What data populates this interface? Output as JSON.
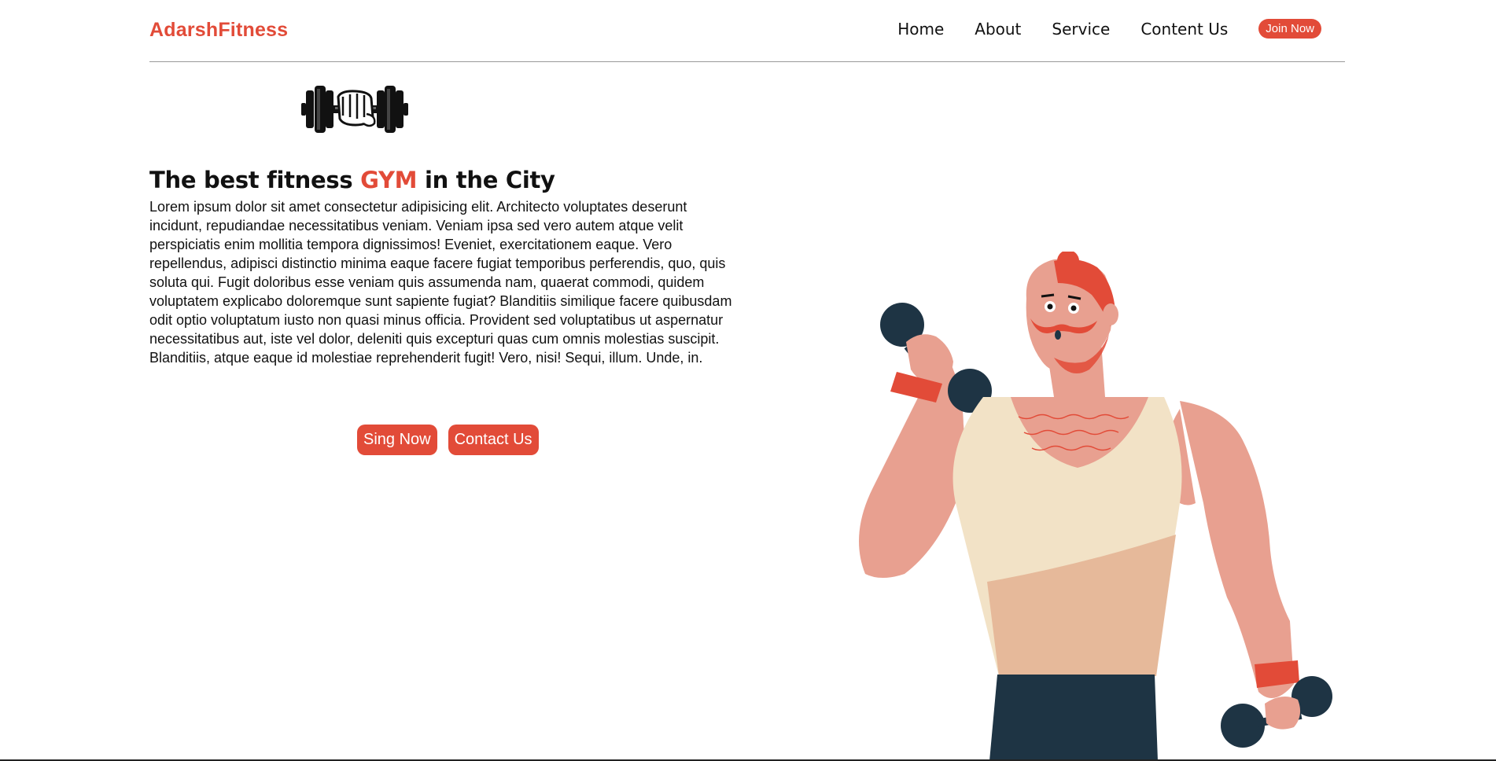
{
  "brand": "AdarshFitness",
  "nav": {
    "items": [
      "Home",
      "About",
      "Service",
      "Content Us"
    ],
    "join_label": "Join Now"
  },
  "hero": {
    "title_part1": "The best fitness ",
    "title_accent": "GYM",
    "title_part2": " in the City",
    "paragraph": "Lorem ipsum dolor sit amet consectetur adipisicing elit. Architecto voluptates deserunt incidunt, repudiandae necessitatibus veniam. Veniam ipsa sed vero autem atque velit perspiciatis enim mollitia tempora dignissimos! Eveniet, exercitationem eaque. Vero repellendus, adipisci distinctio minima eaque facere fugiat temporibus perferendis, quo, quis soluta qui. Fugit doloribus esse veniam quis assumenda nam, quaerat commodi, quidem voluptatem explicabo doloremque sunt sapiente fugiat? Blanditiis similique facere quibusdam odit optio voluptatum iusto non quasi minus officia. Provident sed voluptatibus ut aspernatur necessitatibus aut, iste vel dolor, deleniti quis excepturi quas cum omnis molestias suscipit. Blanditiis, atque eaque id molestiae reprehenderit fugit! Vero, nisi! Sequi, illum. Unde, in.",
    "sign_label": "Sing Now",
    "contact_label": "Contact Us"
  },
  "colors": {
    "accent": "#e24b38",
    "text": "#111111",
    "skin": "#e8a090",
    "tank": "#f2e2c6",
    "dark": "#1e3444"
  },
  "icons": {
    "logo": "dumbbell-fist-icon",
    "illustration": "man-lifting-dumbbells"
  }
}
